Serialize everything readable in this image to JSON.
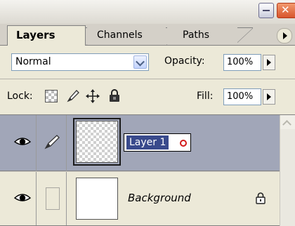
{
  "window": {
    "minimize_icon": "minimize-icon",
    "close_icon": "close-x-icon"
  },
  "tabs": [
    {
      "label": "Layers",
      "active": true
    },
    {
      "label": "Channels",
      "active": false
    },
    {
      "label": "Paths",
      "active": false
    }
  ],
  "blend": {
    "mode": "Normal",
    "opacity_label": "Opacity:",
    "opacity_value": "100%"
  },
  "lock": {
    "label": "Lock:",
    "icons": [
      "lock-transparent-pixels-icon",
      "lock-image-pixels-icon",
      "lock-position-icon",
      "lock-all-icon"
    ],
    "fill_label": "Fill:",
    "fill_value": "100%"
  },
  "layers": [
    {
      "name": "Layer 1",
      "selected": true,
      "editing": true,
      "visible": true,
      "thumbnail": "transparent"
    },
    {
      "name": "Background",
      "selected": false,
      "locked": true,
      "visible": true,
      "thumbnail": "white"
    }
  ],
  "colors": {
    "panel_bg": "#ece9d8",
    "selected_row": "#a1a6b8",
    "name_highlight": "#394a8c"
  }
}
